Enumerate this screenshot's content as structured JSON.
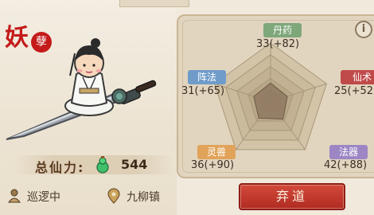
{
  "seal": {
    "char_main": "妖",
    "char_small": "孽"
  },
  "power": {
    "label": "总仙力:",
    "value": "544",
    "icon": "spirit-gourd-icon"
  },
  "status": {
    "patrol": {
      "icon": "patrol-figure-icon",
      "label": "巡逻中"
    },
    "location": {
      "icon": "map-pin-icon",
      "label": "九柳镇"
    }
  },
  "stats": {
    "alchemy": {
      "label": "丹药",
      "value": "33(+82)",
      "color": "#7ea77a"
    },
    "formation": {
      "label": "阵法",
      "value": "31(+65)",
      "color": "#6f9cc9"
    },
    "immortal_arts": {
      "label": "仙术",
      "value": "25(+52",
      "color": "#c04a4a"
    },
    "spirit_beast": {
      "label": "灵兽",
      "value": "36(+90)",
      "color": "#e1a35a"
    },
    "artifact": {
      "label": "法器",
      "value": "42(+88)",
      "color": "#9c86c4"
    }
  },
  "radar_levels": {
    "alchemy": 0.32,
    "immortal_arts": 0.3,
    "artifact": 0.36,
    "spirit_beast": 0.34,
    "formation": 0.3
  },
  "info_button": {
    "label": "i"
  },
  "actions": {
    "quit_label": "弃道"
  }
}
